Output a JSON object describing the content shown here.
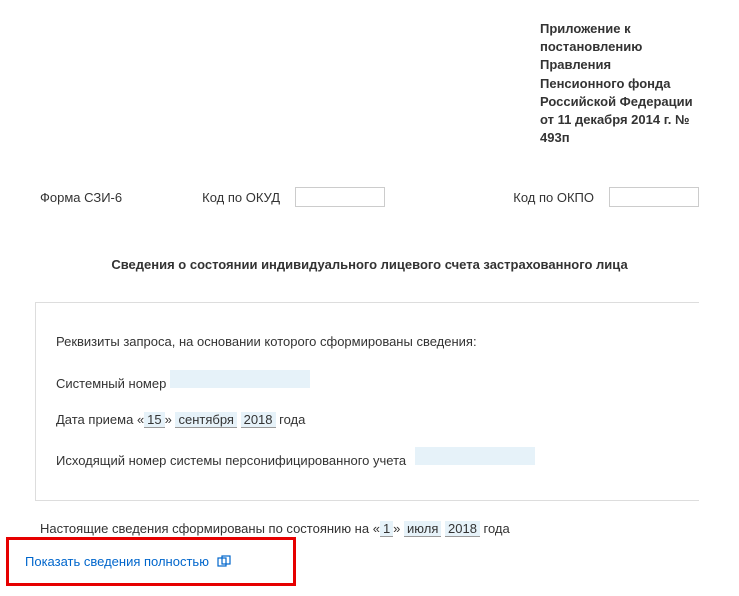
{
  "header": {
    "attachment_text": "Приложение к постановлению Правления Пенсионного фонда Российской Федерации от 11 декабря 2014 г. № 493п"
  },
  "form_codes": {
    "form_label": "Форма СЗИ-6",
    "okud_label": "Код по ОКУД",
    "okud_value": "",
    "okpo_label": "Код по ОКПО",
    "okpo_value": ""
  },
  "title": "Сведения о состоянии индивидуального лицевого счета застрахованного лица",
  "request": {
    "intro": "Реквизиты запроса, на основании которого сформированы сведения:",
    "sys_number_label": "Системный номер",
    "sys_number_value": "",
    "date_label_prefix": "Дата приема «",
    "date_day": "15",
    "date_mid": "» ",
    "date_month": "сентября",
    "date_year": "2018",
    "date_suffix": " года",
    "outgoing_label": "Исходящий номер системы персонифицированного учета",
    "outgoing_value": ""
  },
  "status": {
    "prefix": "Настоящие сведения сформированы по состоянию на   «",
    "day": "1",
    "mid": "» ",
    "month": "июля",
    "year": "2018",
    "suffix": "  года"
  },
  "expand": {
    "label": "Показать сведения полностью"
  }
}
